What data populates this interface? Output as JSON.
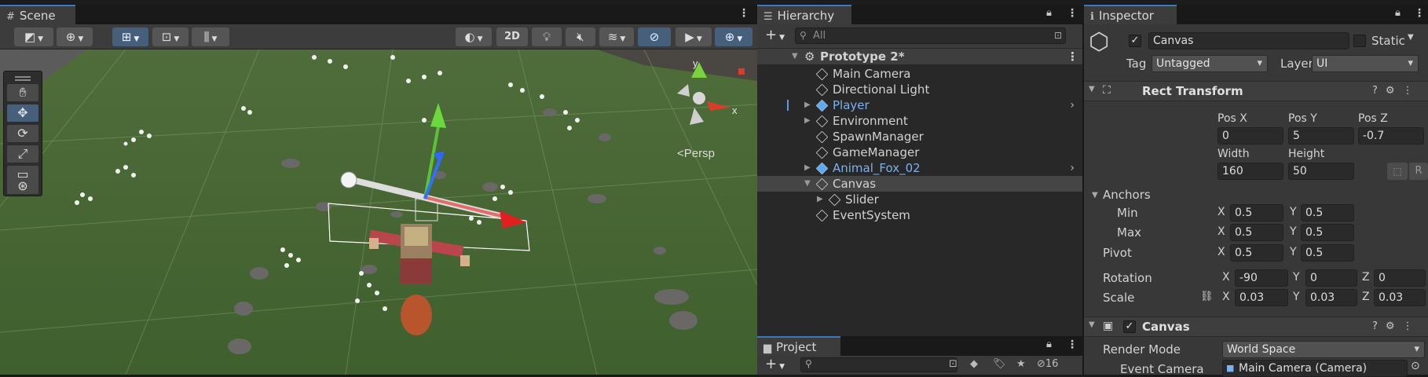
{
  "scene_panel": {
    "tab": "Scene",
    "toolbar": {
      "mode_2d": "2D"
    },
    "gizmo": {
      "y_label": "y",
      "x_label": "x",
      "projection": "Persp"
    }
  },
  "hierarchy": {
    "tab": "Hierarchy",
    "add": "+",
    "search_placeholder": "All",
    "scene_name": "Prototype 2*",
    "items": [
      {
        "label": "Main Camera",
        "depth": 1,
        "expandable": false,
        "prefab": false
      },
      {
        "label": "Directional Light",
        "depth": 1,
        "expandable": false,
        "prefab": false
      },
      {
        "label": "Player",
        "depth": 1,
        "expandable": true,
        "prefab": true
      },
      {
        "label": "Environment",
        "depth": 1,
        "expandable": true,
        "prefab": false
      },
      {
        "label": "SpawnManager",
        "depth": 1,
        "expandable": false,
        "prefab": false
      },
      {
        "label": "GameManager",
        "depth": 1,
        "expandable": false,
        "prefab": false
      },
      {
        "label": "Animal_Fox_02",
        "depth": 1,
        "expandable": true,
        "prefab": true
      },
      {
        "label": "Canvas",
        "depth": 1,
        "expandable": true,
        "prefab": false
      },
      {
        "label": "Slider",
        "depth": 2,
        "expandable": true,
        "prefab": false
      },
      {
        "label": "EventSystem",
        "depth": 1,
        "expandable": false,
        "prefab": false
      }
    ]
  },
  "project": {
    "tab": "Project",
    "add": "+",
    "hidden_count": "16"
  },
  "inspector": {
    "tab": "Inspector",
    "object_name": "Canvas",
    "static_label": "Static",
    "tag_label": "Tag",
    "tag_value": "Untagged",
    "layer_label": "Layer",
    "layer_value": "UI",
    "rect_transform": {
      "title": "Rect Transform",
      "pos_x_label": "Pos X",
      "pos_y_label": "Pos Y",
      "pos_z_label": "Pos Z",
      "pos_x": "0",
      "pos_y": "5",
      "pos_z": "-0.7",
      "width_label": "Width",
      "height_label": "Height",
      "width": "160",
      "height": "50",
      "anchors_label": "Anchors",
      "min_label": "Min",
      "max_label": "Max",
      "pivot_label": "Pivot",
      "x": "X",
      "y": "Y",
      "z": "Z",
      "min_x": "0.5",
      "min_y": "0.5",
      "max_x": "0.5",
      "max_y": "0.5",
      "pivot_x": "0.5",
      "pivot_y": "0.5",
      "rotation_label": "Rotation",
      "rot_x": "-90",
      "rot_y": "0",
      "rot_z": "0",
      "scale_label": "Scale",
      "scale_x": "0.03",
      "scale_y": "0.03",
      "scale_z": "0.03",
      "r_button": "R"
    },
    "canvas": {
      "title": "Canvas",
      "render_mode_label": "Render Mode",
      "render_mode": "World Space",
      "event_camera_label": "Event Camera",
      "event_camera": "Main Camera (Camera)"
    }
  },
  "colors": {
    "accent": "#3a79bb",
    "ground": "#4a6a36",
    "prefab_blue": "#7ab2ef"
  }
}
